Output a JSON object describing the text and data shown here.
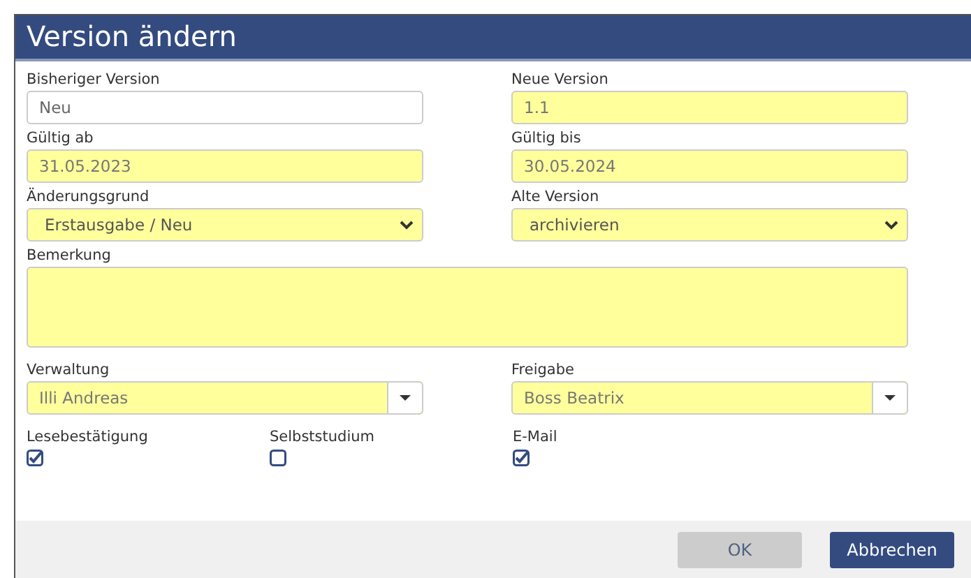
{
  "window": {
    "title": "Version ändern"
  },
  "fields": [
    {
      "kind": "text",
      "label": "Bisheriger Version",
      "value": "Neu",
      "required": false
    },
    {
      "kind": "text",
      "label": "Neue Version",
      "value": "1.1",
      "required": true
    },
    {
      "kind": "text",
      "label": "Gültig ab",
      "value": "31.05.2023",
      "required": true
    },
    {
      "kind": "text",
      "label": "Gültig bis",
      "value": "30.05.2024",
      "required": true
    },
    {
      "kind": "select",
      "label": "Änderungsgrund",
      "value": "Erstausgabe / Neu",
      "required": true
    },
    {
      "kind": "select",
      "label": "Alte Version",
      "value": "archivieren",
      "required": true
    },
    {
      "kind": "textarea",
      "label": "Bemerkung",
      "required": true
    },
    {
      "kind": "combo",
      "label": "Verwaltung",
      "value": "Illi Andreas",
      "required": true
    },
    {
      "kind": "combo",
      "label": "Freigabe",
      "value": "Boss Beatrix",
      "required": true
    }
  ],
  "checkboxes": [
    {
      "label": "Lesebestätigung",
      "checked": true
    },
    {
      "label": "Selbststudium",
      "checked": false
    },
    {
      "label": "E-Mail",
      "checked": true
    }
  ],
  "buttons": [
    {
      "label": "OK",
      "kind": "default",
      "disabled": true
    },
    {
      "label": "Abbrechen",
      "kind": "primary",
      "disabled": false
    }
  ]
}
